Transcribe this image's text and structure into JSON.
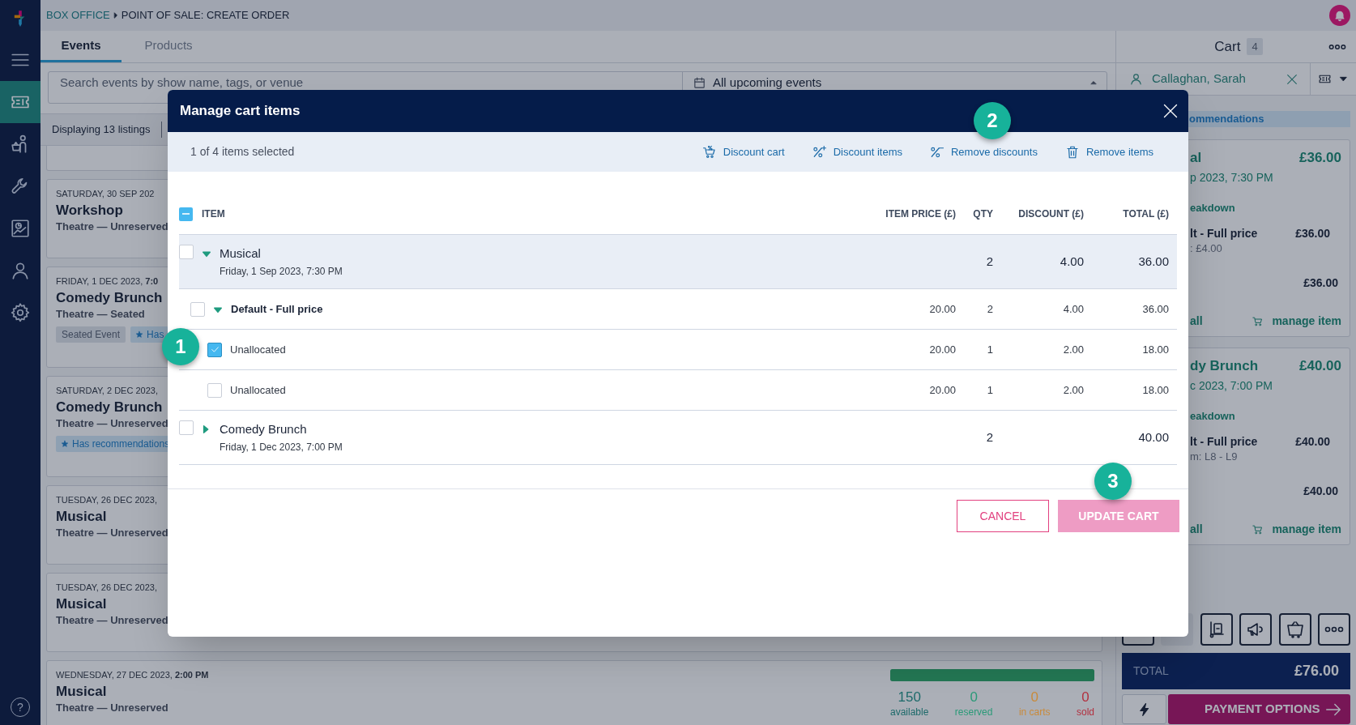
{
  "breadcrumb": [
    {
      "label": "BOX OFFICE"
    },
    {
      "label": "POINT OF SALE: CREATE ORDER"
    }
  ],
  "sidebar": {
    "items": [
      {
        "kind": "menu",
        "selected": false
      },
      {
        "kind": "tickets",
        "selected": true
      },
      {
        "kind": "customers",
        "selected": false
      },
      {
        "kind": "tools",
        "selected": false
      },
      {
        "kind": "reports",
        "selected": false
      },
      {
        "kind": "account",
        "selected": false
      },
      {
        "kind": "settings",
        "selected": false
      }
    ],
    "help": "?"
  },
  "tabs": [
    {
      "label": "Events",
      "selected": true
    },
    {
      "label": "Products",
      "selected": false
    }
  ],
  "search": {
    "placeholder": "Search events by show name, tags, or venue",
    "date_filter": "All upcoming events"
  },
  "listings": {
    "summary": "Displaying 13 listings",
    "events": [
      {
        "date": "SATURDAY, 30 SEP 202",
        "title": "Workshop",
        "venue": "Theatre — Unreserved"
      },
      {
        "date": "FRIDAY, 1 DEC 2023, **7:0**",
        "title": "Comedy Brunch",
        "venue": "Theatre — Seated",
        "tags": [
          {
            "kind": "plain",
            "label": "Seated Event"
          },
          {
            "kind": "recommendation",
            "label": "Has"
          }
        ]
      },
      {
        "date": "SATURDAY, 2 DEC 2023,",
        "title": "Comedy Brunch",
        "venue": "Theatre — Unreserved",
        "tags": [
          {
            "kind": "recommendation",
            "label": "Has recommendations"
          }
        ]
      },
      {
        "date": "TUESDAY, 26 DEC 2023,",
        "title": "Musical",
        "venue": "Theatre — Unreserved"
      },
      {
        "date": "TUESDAY, 26 DEC 2023,",
        "title": "Musical",
        "venue": "Theatre — Unreserved"
      },
      {
        "date": "WEDNESDAY, 27 DEC 2023, **2:00 PM**",
        "title": "Musical",
        "venue": "Theatre — Unreserved",
        "availability": {
          "level": 1,
          "stats": [
            {
              "value": "150",
              "label": "available",
              "color": "#1d6a6a"
            },
            {
              "value": "0",
              "label": "reserved",
              "color": "#2a9a78"
            },
            {
              "value": "0",
              "label": "in carts",
              "color": "#c98a3a"
            },
            {
              "value": "0",
              "label": "sold",
              "color": "#b2303f"
            }
          ]
        }
      }
    ]
  },
  "cart": {
    "title": "Cart",
    "count": "4",
    "customer": "Callaghan, Sarah",
    "banner": "ommendations",
    "items": [
      {
        "name": "al",
        "price": "£36.00",
        "date": "p 2023, 7:30 PM",
        "breakdown": "eakdown",
        "line": "lt - Full price",
        "line_price": "£36.00",
        "line_detail": ": £4.00",
        "subtotal": "£36.00",
        "action_left": "all",
        "action_right": "manage item"
      },
      {
        "name": "dy Brunch",
        "price": "£40.00",
        "date": "c 2023, 7:00 PM",
        "breakdown": "eakdown",
        "line": "lt - Full price",
        "line_price": "£40.00",
        "line_detail": "m: L8 - L9",
        "subtotal": "£40.00",
        "action_left": "all",
        "action_right": "manage item"
      }
    ],
    "total_label": "TOTAL",
    "total": "£76.00",
    "payment": "PAYMENT OPTIONS"
  },
  "modal": {
    "title": "Manage cart items",
    "selection": "1 of 4 items selected",
    "actions": [
      {
        "kind": "discount-cart",
        "label": "Discount cart"
      },
      {
        "kind": "discount-items",
        "label": "Discount items"
      },
      {
        "kind": "remove-discounts",
        "label": "Remove discounts"
      },
      {
        "kind": "remove-items",
        "label": "Remove items"
      }
    ],
    "select_all": {
      "partial": true
    },
    "columns": [
      "ITEM",
      "ITEM PRICE (£)",
      "QTY",
      "DISCOUNT (£)",
      "TOTAL (£)"
    ],
    "rows": [
      {
        "name": "Musical",
        "date": "Friday, 1 Sep 2023, 7:30 PM",
        "qty": "2",
        "discount": "4.00",
        "total": "36.00",
        "checked": false,
        "expanded": true,
        "children": [
          {
            "name": "Default - Full price",
            "price": "20.00",
            "qty": "2",
            "discount": "4.00",
            "total": "36.00",
            "checked": false,
            "expanded": true,
            "children": [
              {
                "name": "Unallocated",
                "price": "20.00",
                "qty": "1",
                "discount": "2.00",
                "total": "18.00",
                "checked": true
              },
              {
                "name": "Unallocated",
                "price": "20.00",
                "qty": "1",
                "discount": "2.00",
                "total": "18.00",
                "checked": false
              }
            ]
          }
        ]
      },
      {
        "name": "Comedy Brunch",
        "date": "Friday, 1 Dec 2023, 7:00 PM",
        "qty": "2",
        "total": "40.00",
        "checked": false,
        "expanded": false
      }
    ],
    "buttons": [
      {
        "kind": "secondary",
        "label": "CANCEL",
        "disabled": false
      },
      {
        "kind": "primary",
        "label": "UPDATE CART",
        "disabled": true
      }
    ]
  },
  "callouts": [
    {
      "label": "1"
    },
    {
      "label": "2"
    },
    {
      "label": "3"
    }
  ]
}
